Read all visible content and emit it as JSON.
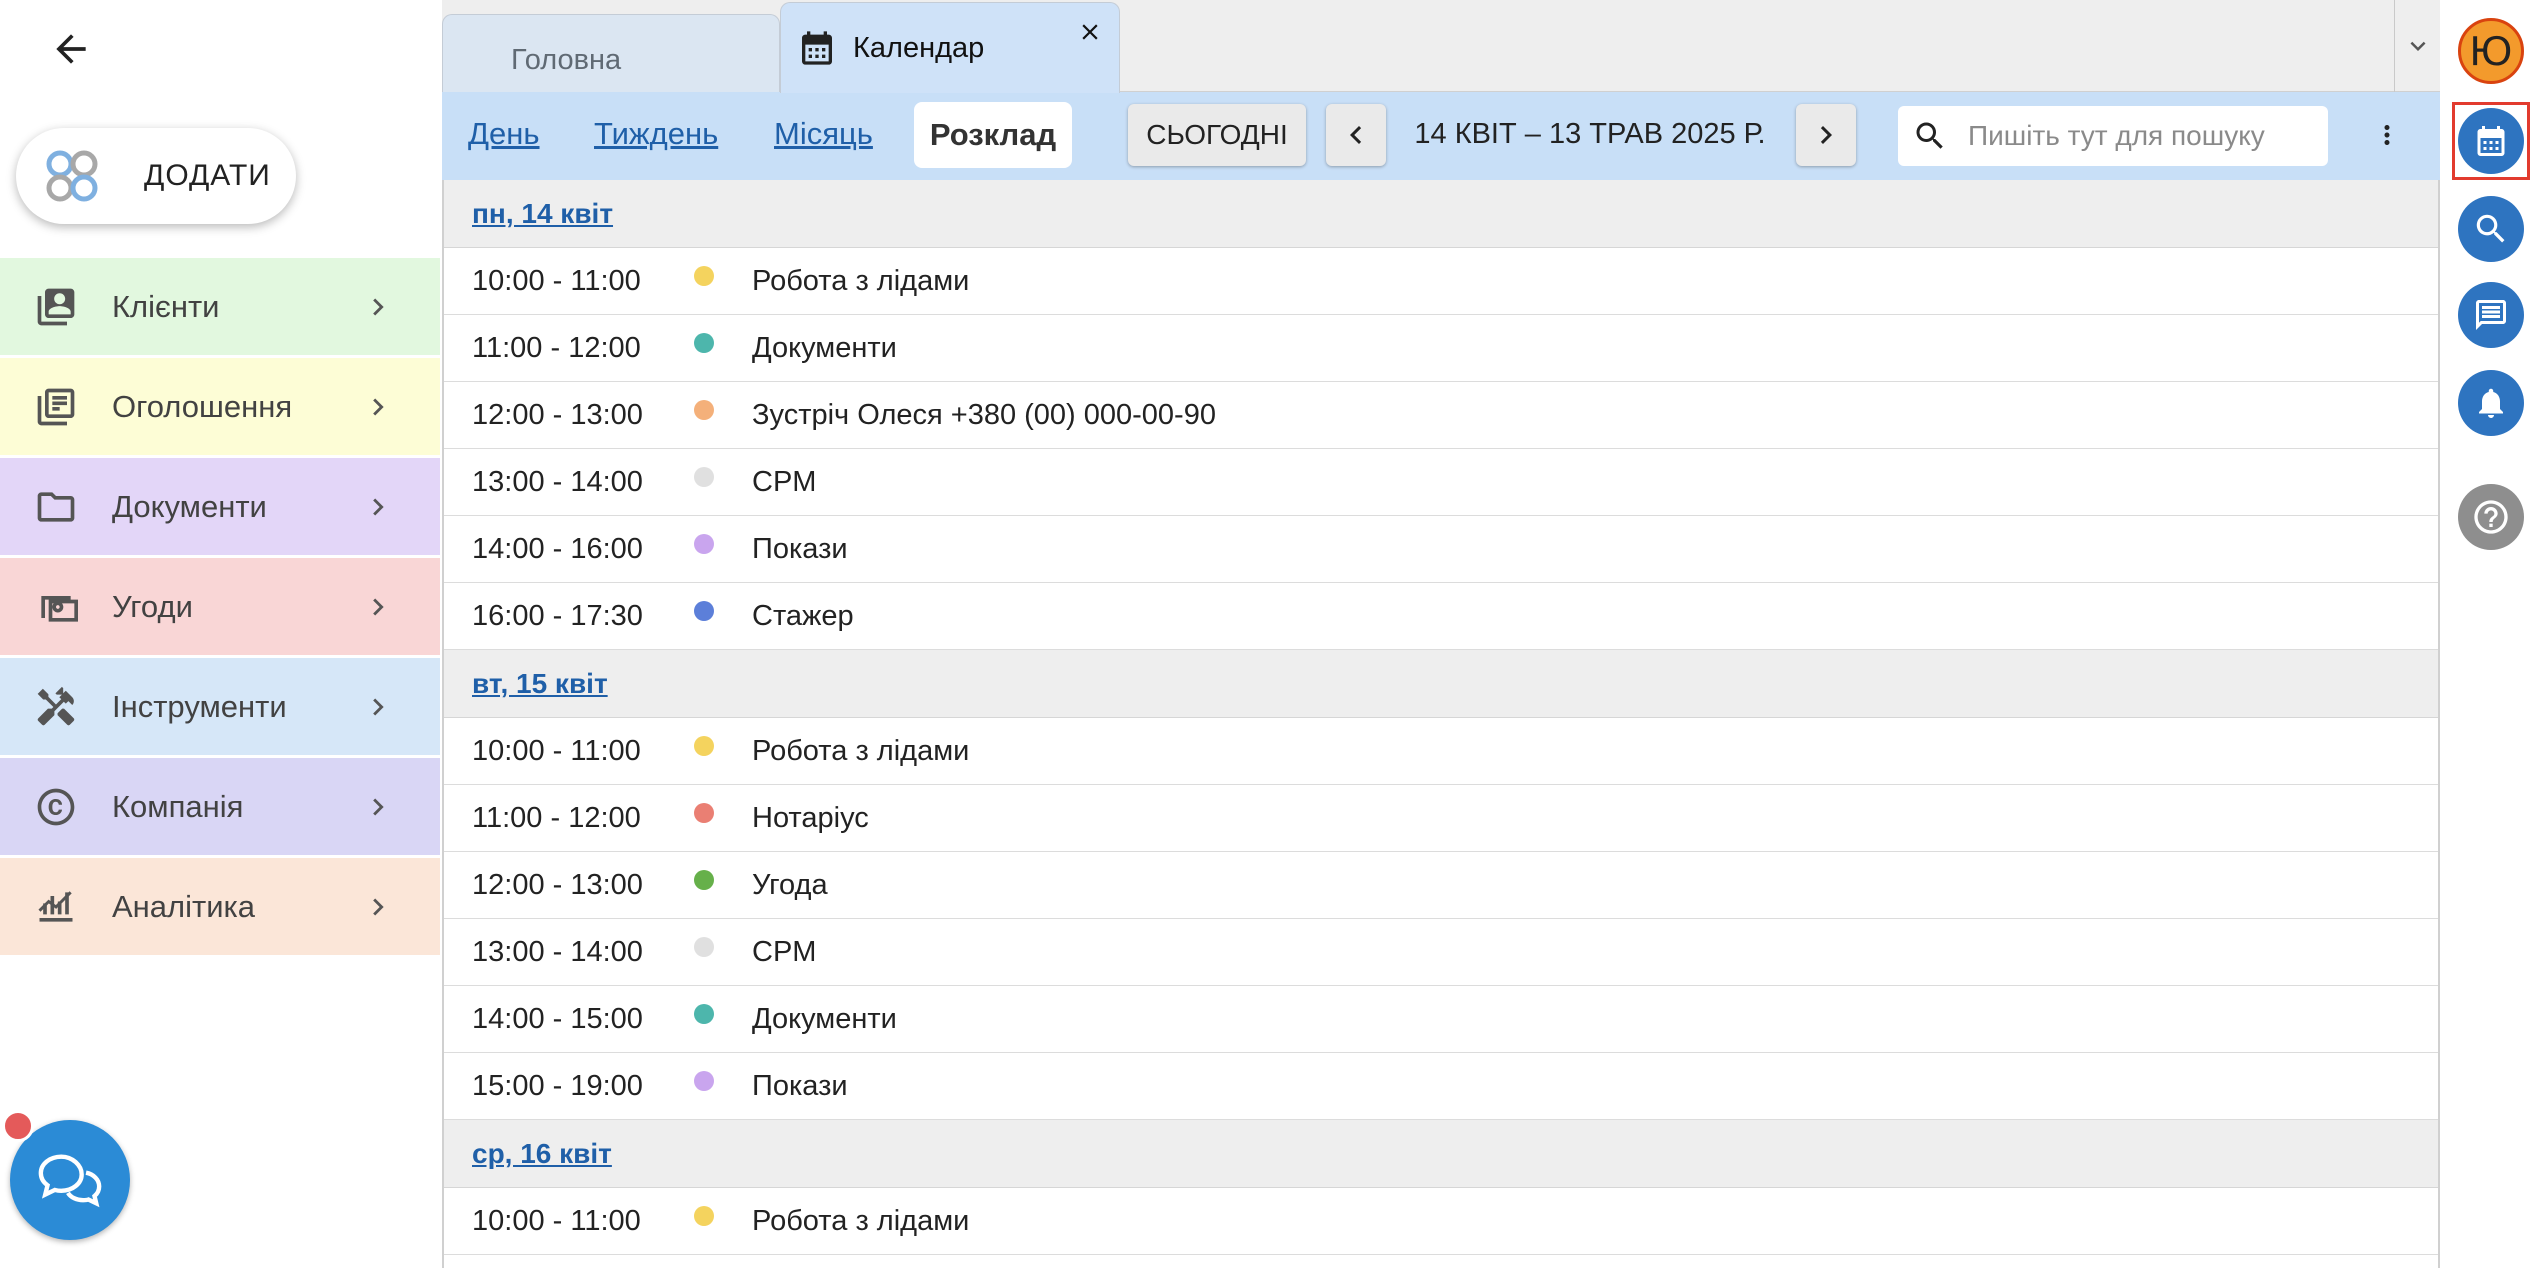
{
  "sidebar": {
    "add_label": "ДОДАТИ",
    "items": [
      {
        "label": "Клієнти",
        "icon": "contacts-icon",
        "color": "#e2f8df"
      },
      {
        "label": "Оголошення",
        "icon": "listing-icon",
        "color": "#fdfdd6"
      },
      {
        "label": "Документи",
        "icon": "folder-icon",
        "color": "#e3d6f8"
      },
      {
        "label": "Угоди",
        "icon": "money-icon",
        "color": "#f9d6d6"
      },
      {
        "label": "Інструменти",
        "icon": "tools-icon",
        "color": "#d6e7f8"
      },
      {
        "label": "Компанія",
        "icon": "copyright-icon",
        "color": "#d9d6f5"
      },
      {
        "label": "Аналітика",
        "icon": "analytics-icon",
        "color": "#fbe6d8"
      }
    ]
  },
  "tabs": {
    "home_label": "Головна",
    "calendar_label": "Календар"
  },
  "toolbar": {
    "views": [
      "День",
      "Тиждень",
      "Місяць"
    ],
    "active_view": "Розклад",
    "today_label": "СЬОГОДНІ",
    "range_label": "14 КВІТ – 13 ТРАВ 2025 Р.",
    "search_placeholder": "Пишіть тут для пошуку"
  },
  "schedule": {
    "days": [
      {
        "label": "пн, 14 квіт",
        "events": [
          {
            "time": "10:00 - 11:00",
            "title": "Робота з лідами",
            "color": "#f4d35e"
          },
          {
            "time": "11:00 - 12:00",
            "title": "Документи",
            "color": "#4db6ac"
          },
          {
            "time": "12:00 - 13:00",
            "title": "Зустріч Олеся +380 (00) 000-00-90",
            "color": "#f4b07a"
          },
          {
            "time": "13:00 - 14:00",
            "title": "CPM",
            "color": "#e0e0e0"
          },
          {
            "time": "14:00 - 16:00",
            "title": "Покази",
            "color": "#c9a5ee"
          },
          {
            "time": "16:00 - 17:30",
            "title": "Стажер",
            "color": "#5c7fd9"
          }
        ]
      },
      {
        "label": "вт, 15 квіт",
        "events": [
          {
            "time": "10:00 - 11:00",
            "title": "Робота з лідами",
            "color": "#f4d35e"
          },
          {
            "time": "11:00 - 12:00",
            "title": "Нотаріус",
            "color": "#ea7f73"
          },
          {
            "time": "12:00 - 13:00",
            "title": "Угода",
            "color": "#66b04a"
          },
          {
            "time": "13:00 - 14:00",
            "title": "CPM",
            "color": "#e0e0e0"
          },
          {
            "time": "14:00 - 15:00",
            "title": "Документи",
            "color": "#4db6ac"
          },
          {
            "time": "15:00 - 19:00",
            "title": "Покази",
            "color": "#c9a5ee"
          }
        ]
      },
      {
        "label": "ср, 16 квіт",
        "events": [
          {
            "time": "10:00 - 11:00",
            "title": "Робота з лідами",
            "color": "#f4d35e"
          }
        ]
      }
    ]
  },
  "rail": {
    "avatar_letter": "Ю",
    "accent": "#2e74c0",
    "highlight": "#e23b2e"
  }
}
